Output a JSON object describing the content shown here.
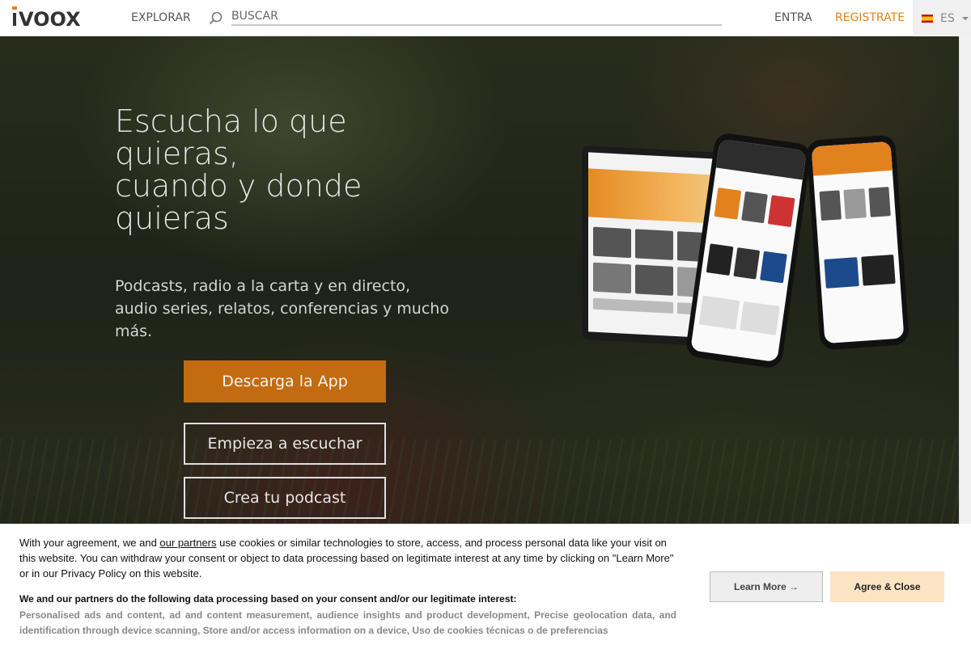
{
  "header": {
    "logo_text": "iVOOX",
    "explore_label": "EXPLORAR",
    "search_placeholder": "BUSCAR",
    "login_label": "ENTRA",
    "register_label": "REGISTRATE",
    "language_label": "ES",
    "accent_color": "#e2821e"
  },
  "hero": {
    "title": "Escucha lo que\nquieras,\ncuando y donde\nquieras",
    "subtitle": "Podcasts, radio a la carta y en directo, audio series, relatos, conferencias y mucho más.",
    "download_app_label": "Descarga la App",
    "start_listening_label": "Empieza a escuchar",
    "create_podcast_label": "Crea tu podcast"
  },
  "cookie_banner": {
    "text_before_link": "With your agreement, we and ",
    "partners_link": "our partners",
    "text_after_link": " use cookies or similar technologies to store, access, and process personal data like your visit on this website. You can withdraw your consent or object to data processing based on legitimate interest at any time by clicking on \"Learn More\" or in our Privacy Policy on this website.",
    "purposes_heading": "We and our partners do the following data processing based on your consent and/or our legitimate interest:",
    "purposes_list": "Personalised ads and content, ad and content measurement, audience insights and product development, Precise geolocation data, and identification through device scanning, Store and/or access information on a device, Uso de cookies técnicas o de preferencias",
    "learn_more_label": "Learn More →",
    "agree_label": "Agree & Close"
  }
}
